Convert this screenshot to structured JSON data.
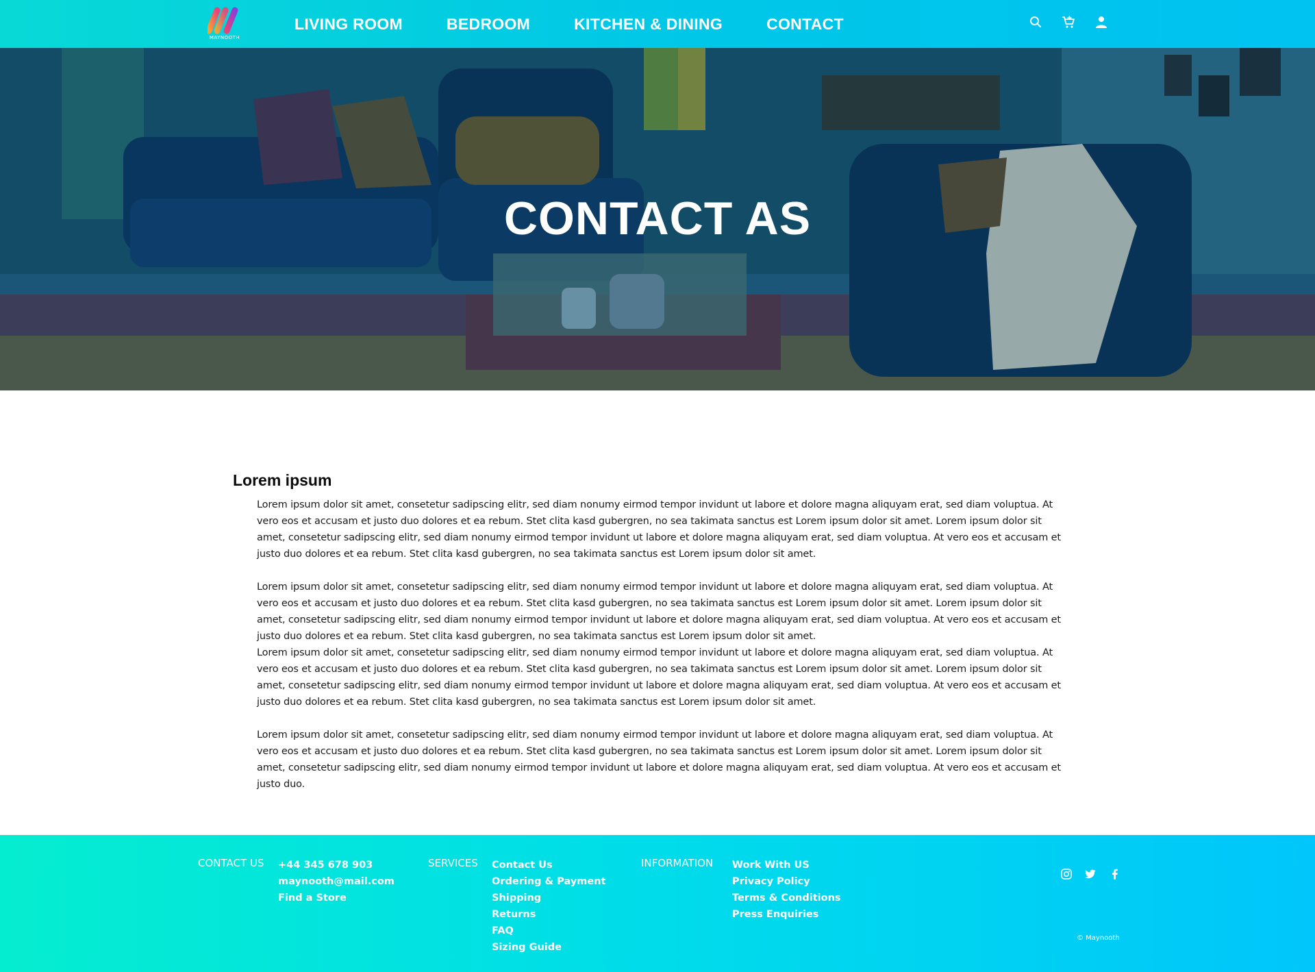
{
  "brand": {
    "name": "MAYNOOTH",
    "colors": {
      "teal": "#08d9d6",
      "cyan": "#00c3f2",
      "logo_orange": "#f7a531",
      "logo_pink": "#e8437a",
      "logo_purple": "#8a3ed6"
    }
  },
  "header": {
    "nav": [
      "LIVING ROOM",
      "BEDROOM",
      "KITCHEN & DINING",
      "CONTACT"
    ],
    "icons": [
      "search-icon",
      "cart-icon",
      "user-icon"
    ]
  },
  "hero": {
    "title": "CONTACT AS"
  },
  "main": {
    "heading": "Lorem ipsum",
    "paragraphs": [
      "Lorem ipsum dolor sit amet, consetetur sadipscing elitr, sed diam nonumy eirmod tempor invidunt ut labore et dolore magna aliquyam erat, sed diam voluptua. At vero eos et accusam et justo duo dolores et ea rebum. Stet clita kasd gubergren, no sea takimata sanctus est Lorem ipsum dolor sit amet. Lorem ipsum dolor sit amet, consetetur sadipscing elitr, sed diam nonumy eirmod tempor invidunt ut labore et dolore magna aliquyam erat, sed diam voluptua. At vero eos et accusam et justo duo dolores et ea rebum. Stet clita kasd gubergren, no sea takimata sanctus est Lorem ipsum dolor sit amet.",
      "Lorem ipsum dolor sit amet, consetetur sadipscing elitr, sed diam nonumy eirmod tempor invidunt ut labore et dolore magna aliquyam erat, sed diam voluptua. At vero eos et accusam et justo duo dolores et ea rebum. Stet clita kasd gubergren, no sea takimata sanctus est Lorem ipsum dolor sit amet. Lorem ipsum dolor sit amet, consetetur sadipscing elitr, sed diam nonumy eirmod tempor invidunt ut labore et dolore magna aliquyam erat, sed diam voluptua. At vero eos et accusam et justo duo dolores et ea rebum. Stet clita kasd gubergren, no sea takimata sanctus est Lorem ipsum dolor sit amet.",
      "Lorem ipsum dolor sit amet, consetetur sadipscing elitr, sed diam nonumy eirmod tempor invidunt ut labore et dolore magna aliquyam erat, sed diam voluptua. At vero eos et accusam et justo duo dolores et ea rebum. Stet clita kasd gubergren, no sea takimata sanctus est Lorem ipsum dolor sit amet. Lorem ipsum dolor sit amet, consetetur sadipscing elitr, sed diam nonumy eirmod tempor invidunt ut labore et dolore magna aliquyam erat, sed diam voluptua. At vero eos et accusam et justo duo dolores et ea rebum. Stet clita kasd gubergren, no sea takimata sanctus est Lorem ipsum dolor sit amet.",
      "Lorem ipsum dolor sit amet, consetetur sadipscing elitr, sed diam nonumy eirmod tempor invidunt ut labore et dolore magna aliquyam erat, sed diam voluptua. At vero eos et accusam et justo duo dolores et ea rebum. Stet clita kasd gubergren, no sea takimata sanctus est Lorem ipsum dolor sit amet. Lorem ipsum dolor sit amet, consetetur sadipscing elitr, sed diam nonumy eirmod tempor invidunt ut labore et dolore magna aliquyam erat, sed diam voluptua. At vero eos et accusam et justo duo."
    ]
  },
  "footer": {
    "contact": {
      "heading": "CONTACT US",
      "items": [
        "+44 345 678 903",
        "maynooth@mail.com",
        "Find a Store"
      ]
    },
    "services": {
      "heading": "SERVICES",
      "items": [
        "Contact Us",
        "Ordering & Payment",
        "Shipping",
        "Returns",
        "FAQ",
        "Sizing Guide"
      ]
    },
    "information": {
      "heading": "INFORMATION",
      "items": [
        "Work With US",
        "Privacy Policy",
        "Terms & Conditions",
        "Press Enquiries"
      ]
    },
    "socials": [
      "instagram-icon",
      "twitter-icon",
      "facebook-icon"
    ],
    "copyright": "© Maynooth"
  }
}
